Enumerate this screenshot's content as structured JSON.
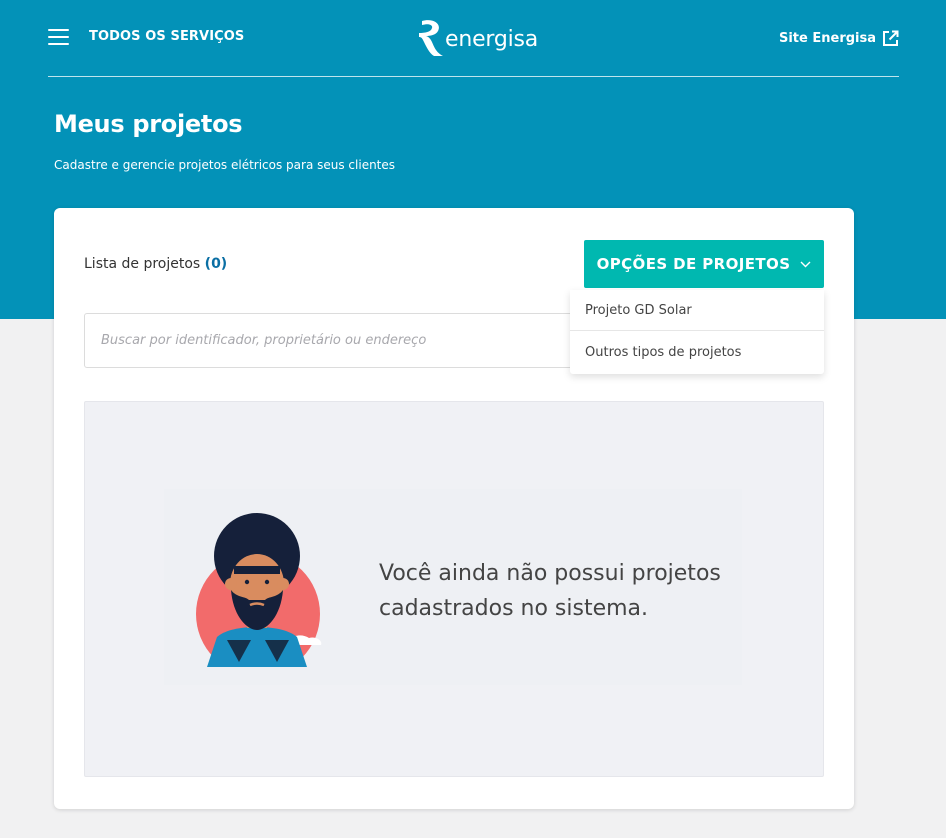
{
  "colors": {
    "brand": "#0392b8",
    "accent": "#00b8b0",
    "count": "#0b6fa4"
  },
  "header": {
    "menu_icon": "hamburger-icon",
    "all_services": "TODOS OS SERVIÇOS",
    "logo_text": "energisa",
    "site_link": "Site Energisa",
    "site_link_icon": "external-link-icon"
  },
  "page": {
    "title": "Meus projetos",
    "subtitle": "Cadastre e gerencie projetos elétricos para seus clientes"
  },
  "projects": {
    "list_label": "Lista de projetos",
    "count": "(0)",
    "options_button": "OPÇÕES DE PROJETOS",
    "options_icon": "chevron-down-icon",
    "search_placeholder": "Buscar por identificador, proprietário ou endereço",
    "search_value": "",
    "search_icon": "search-icon",
    "dropdown": [
      {
        "label": "Projeto GD Solar"
      },
      {
        "label": "Outros tipos de projetos"
      }
    ],
    "empty_message": "Você ainda não possui projetos cadastrados no sistema."
  }
}
